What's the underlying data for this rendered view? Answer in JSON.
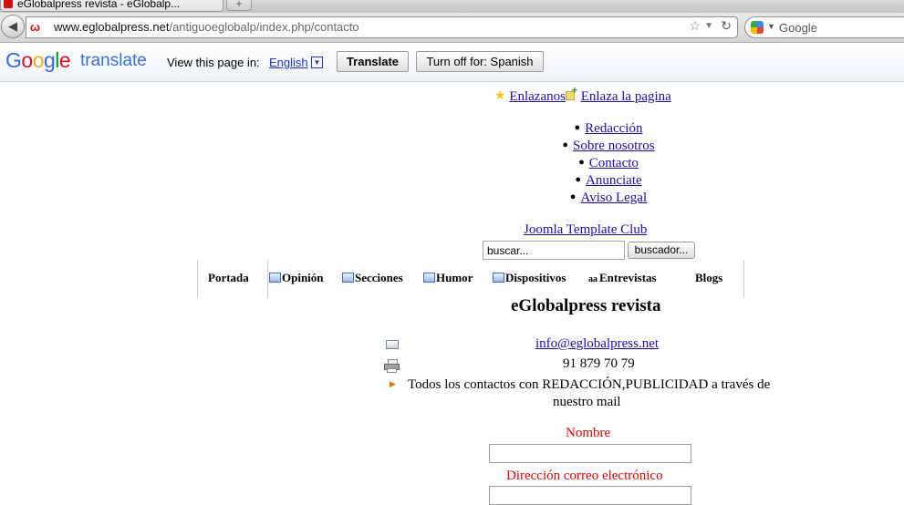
{
  "browser": {
    "tab_title": "eGlobalpress revista - eGlobalp...",
    "new_tab_symbol": "+",
    "url_domain": "www.eglobalpress.net",
    "url_path": "/antiguoeglobalp/index.php/contacto",
    "search_placeholder": "Google"
  },
  "translate_bar": {
    "logo": "Google",
    "word": "translate",
    "label": "View this page in:",
    "language": "English",
    "translate_button": "Translate",
    "turn_off_button": "Turn off for: Spanish"
  },
  "page": {
    "enlazanos": "Enlazanos",
    "enlaza_pagina": "Enlaza la pagina",
    "top_menu": [
      "Redacción",
      "Sobre nosotros",
      "Contacto",
      "Anunciate",
      "Aviso Legal"
    ],
    "template_club": "Joomla Template Club",
    "search_value": "buscar...",
    "search_button": "buscador...",
    "main_menu": [
      "Portada",
      "Opinión",
      "Secciones",
      "Humor",
      "Dispositivos",
      "Entrevistas",
      "Blogs"
    ],
    "entrevistas_glyph": "aa",
    "title": "eGlobalpress revista",
    "email": "info@eglobalpress.net",
    "phone": "91 879 70 79",
    "note_line1": "Todos los contactos con REDACCIÓN,PUBLICIDAD a través de",
    "note_line2": "nuestro mail",
    "form": {
      "name_label": "Nombre",
      "email_label": "Dirección correo electrónico"
    }
  }
}
